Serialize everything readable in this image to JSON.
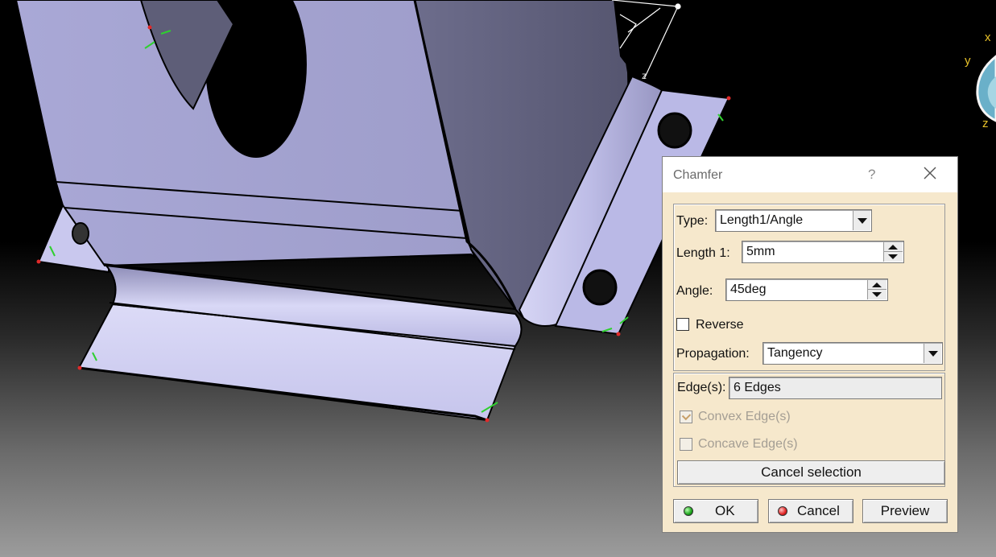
{
  "viewport": {
    "axis_labels": {
      "x": "x",
      "y": "y",
      "z": "z"
    }
  },
  "dialog": {
    "title": "Chamfer",
    "help_glyph": "?",
    "type_label": "Type:",
    "type_value": "Length1/Angle",
    "length1_label": "Length 1:",
    "length1_value": "5mm",
    "angle_label": "Angle:",
    "angle_value": "45deg",
    "reverse_label": "Reverse",
    "reverse_checked": false,
    "propagation_label": "Propagation:",
    "propagation_value": "Tangency",
    "edges_label": "Edge(s):",
    "edges_value": "6 Edges",
    "convex_label": "Convex Edge(s)",
    "convex_checked": true,
    "concave_label": "Concave Edge(s)",
    "concave_checked": false,
    "cancel_selection_label": "Cancel selection",
    "ok_label": "OK",
    "cancel_label": "Cancel",
    "preview_label": "Preview"
  },
  "colors": {
    "part_face": "#b9b8e2",
    "part_face_dark": "#62627f",
    "dialog_bg": "#f6e8cc",
    "axis": "#e8c22a"
  }
}
